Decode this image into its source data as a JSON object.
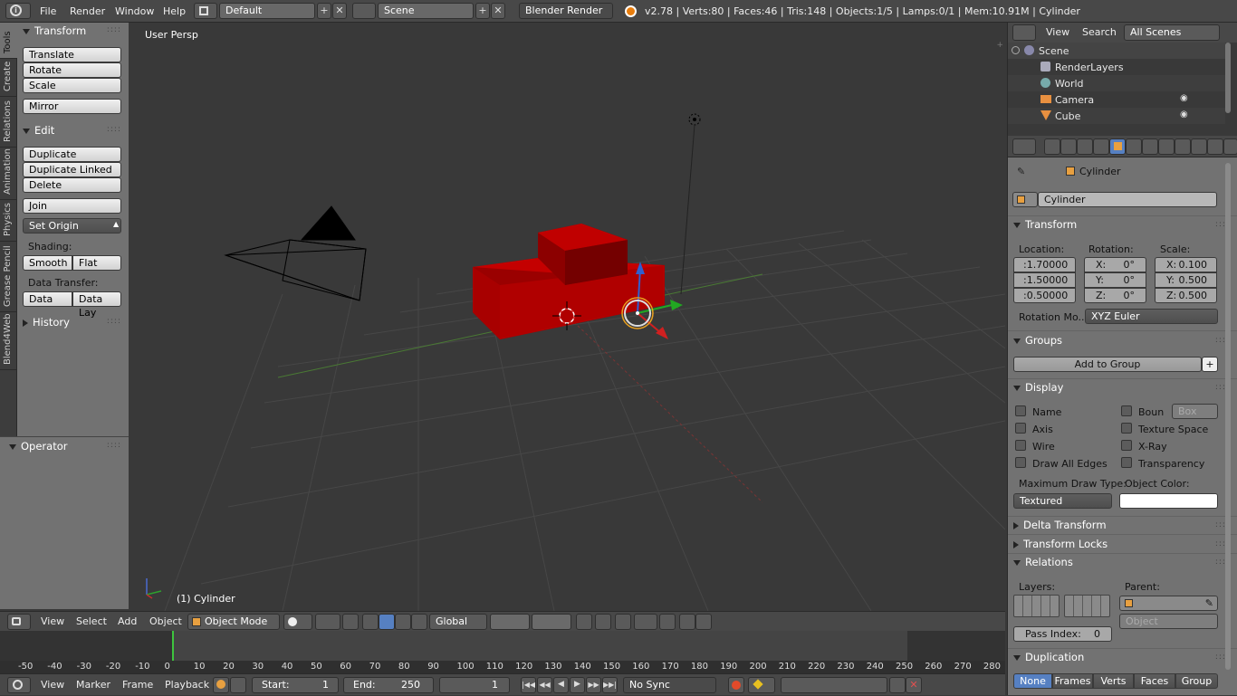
{
  "header": {
    "menus": [
      "File",
      "Render",
      "Window",
      "Help"
    ],
    "screen_layout": "Default",
    "scene": "Scene",
    "render_engine": "Blender Render",
    "stats": "v2.78 | Verts:80 | Faces:46 | Tris:148 | Objects:1/5 | Lamps:0/1 | Mem:10.91M | Cylinder"
  },
  "side_tabs": [
    "Tools",
    "Create",
    "Relations",
    "Animation",
    "Physics",
    "Grease Pencil",
    "Blend4Web"
  ],
  "tool_panel": {
    "transform_title": "Transform",
    "translate": "Translate",
    "rotate": "Rotate",
    "scale": "Scale",
    "mirror": "Mirror",
    "edit_title": "Edit",
    "duplicate": "Duplicate",
    "duplicate_linked": "Duplicate Linked",
    "delete": "Delete",
    "join": "Join",
    "set_origin": "Set Origin",
    "shading_label": "Shading:",
    "smooth": "Smooth",
    "flat": "Flat",
    "data_transfer_label": "Data Transfer:",
    "data": "Data",
    "data_lay": "Data Lay",
    "history_title": "History",
    "operator_title": "Operator"
  },
  "viewport": {
    "view_label": "User Persp",
    "object_label": "(1) Cylinder"
  },
  "viewport_header": {
    "view": "View",
    "select": "Select",
    "add": "Add",
    "object": "Object",
    "mode": "Object Mode",
    "orientation": "Global"
  },
  "timeline": {
    "ticks": [
      "-50",
      "-40",
      "-30",
      "-20",
      "-10",
      "0",
      "10",
      "20",
      "30",
      "40",
      "50",
      "60",
      "70",
      "80",
      "90",
      "100",
      "110",
      "120",
      "130",
      "140",
      "150",
      "160",
      "170",
      "180",
      "190",
      "200",
      "210",
      "220",
      "230",
      "240",
      "250",
      "260",
      "270",
      "280"
    ],
    "current_frame": 0
  },
  "timeline_header": {
    "view": "View",
    "marker": "Marker",
    "frame": "Frame",
    "playback": "Playback",
    "start_label": "Start:",
    "start_value": "1",
    "end_label": "End:",
    "end_value": "250",
    "current": "1",
    "sync": "No Sync"
  },
  "outliner": {
    "view": "View",
    "search": "Search",
    "filter": "All Scenes",
    "items": [
      "Scene",
      "RenderLayers",
      "World",
      "Camera",
      "Cube"
    ]
  },
  "properties": {
    "breadcrumb": "Cylinder",
    "object_name": "Cylinder",
    "transform_title": "Transform",
    "location_label": "Location:",
    "rotation_label": "Rotation:",
    "scale_label": "Scale:",
    "loc_x": ":1.70000",
    "loc_y": ":1.50000",
    "loc_z": ":0.50000",
    "rot_x_label": "X:",
    "rot_x": "0°",
    "rot_y_label": "Y:",
    "rot_y": "0°",
    "rot_z_label": "Z:",
    "rot_z": "0°",
    "scale_x_label": "X:",
    "scale_x": "0.100",
    "scale_y_label": "Y:",
    "scale_y": "0.500",
    "scale_z_label": "Z:",
    "scale_z": "0.500",
    "rotation_mode_label": "Rotation Mo...",
    "rotation_mode": "XYZ Euler",
    "groups_title": "Groups",
    "add_to_group": "Add to Group",
    "display_title": "Display",
    "name": "Name",
    "bounds": "Boun",
    "bounds_type": "Box",
    "axis": "Axis",
    "texture_space": "Texture Space",
    "wire": "Wire",
    "xray": "X-Ray",
    "draw_all_edges": "Draw All Edges",
    "transparency": "Transparency",
    "max_draw_type_label": "Maximum Draw Type:",
    "object_color_label": "Object Color:",
    "max_draw_type": "Textured",
    "delta_transform_title": "Delta Transform",
    "transform_locks_title": "Transform Locks",
    "relations_title": "Relations",
    "layers_label": "Layers:",
    "parent_label": "Parent:",
    "parent_type": "Object",
    "pass_index_label": "Pass Index:",
    "pass_index": "0",
    "duplication_title": "Duplication",
    "dup_none": "None",
    "dup_frames": "Frames",
    "dup_verts": "Verts",
    "dup_faces": "Faces",
    "dup_group": "Group"
  },
  "colors": {
    "object_red": "#b80000",
    "active_blue": "#5680c2",
    "panel_bg": "#727272",
    "viewport_bg": "#393939"
  }
}
